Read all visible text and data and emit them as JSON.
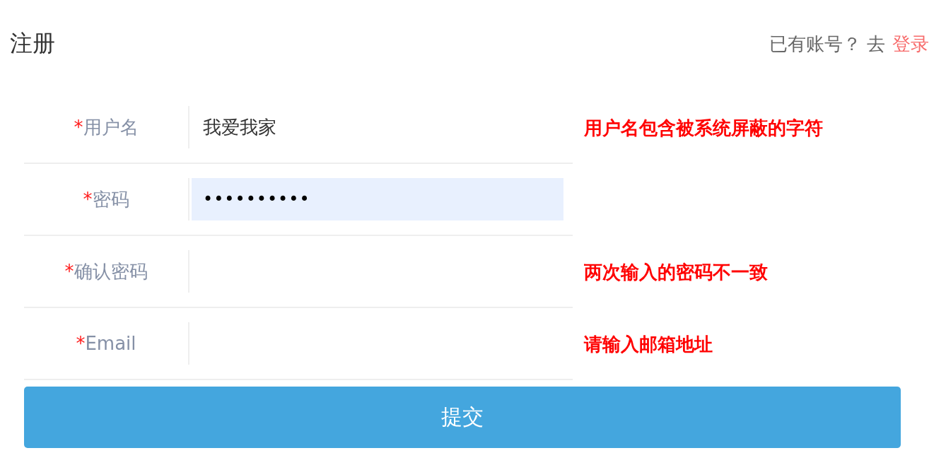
{
  "title": "注册",
  "login_prompt": {
    "text": "已有账号？ 去",
    "link": "登录"
  },
  "fields": [
    {
      "label": "用户名",
      "required_mark": "*",
      "value": "我爱我家",
      "autofilled": false,
      "error": "用户名包含被系统屏蔽的字符"
    },
    {
      "label": "密码",
      "required_mark": "*",
      "value": "••••••••••",
      "autofilled": true
    },
    {
      "label": "确认密码",
      "required_mark": "*",
      "autofilled": false,
      "error": "两次输入的密码不一致"
    },
    {
      "label": "Email",
      "required_mark": "*",
      "autofilled": false,
      "error": "请输入邮箱地址"
    }
  ],
  "submit": {
    "label": "提交"
  }
}
